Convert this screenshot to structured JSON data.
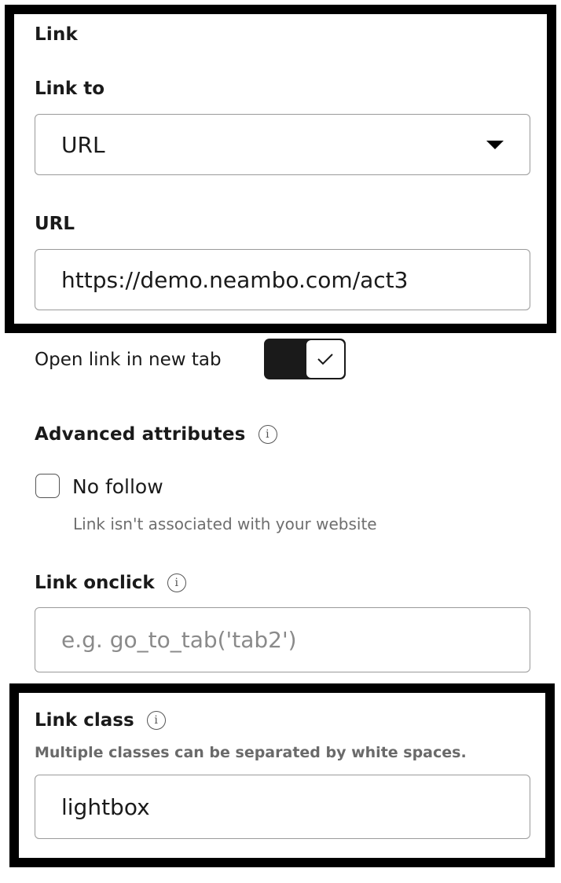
{
  "link_section": {
    "heading": "Link",
    "link_to": {
      "label": "Link to",
      "selected": "URL"
    },
    "url": {
      "label": "URL",
      "value": "https://demo.neambo.com/act3"
    },
    "open_new_tab": {
      "label": "Open link in new tab",
      "checked": true
    }
  },
  "advanced": {
    "heading": "Advanced attributes",
    "info_icon": "i",
    "no_follow": {
      "label": "No follow",
      "checked": false,
      "helper": "Link isn't associated with your website"
    }
  },
  "onclick": {
    "label": "Link onclick",
    "info_icon": "i",
    "placeholder": "e.g. go_to_tab('tab2')",
    "value": ""
  },
  "link_class": {
    "label": "Link class",
    "info_icon": "i",
    "hint": "Multiple classes can be separated by white spaces.",
    "value": "lightbox"
  },
  "colors": {
    "highlight_border": "#000000",
    "toggle_on": "#1a1a1a",
    "field_border": "#9a9a9a",
    "helper_text": "#6e6e6e"
  }
}
